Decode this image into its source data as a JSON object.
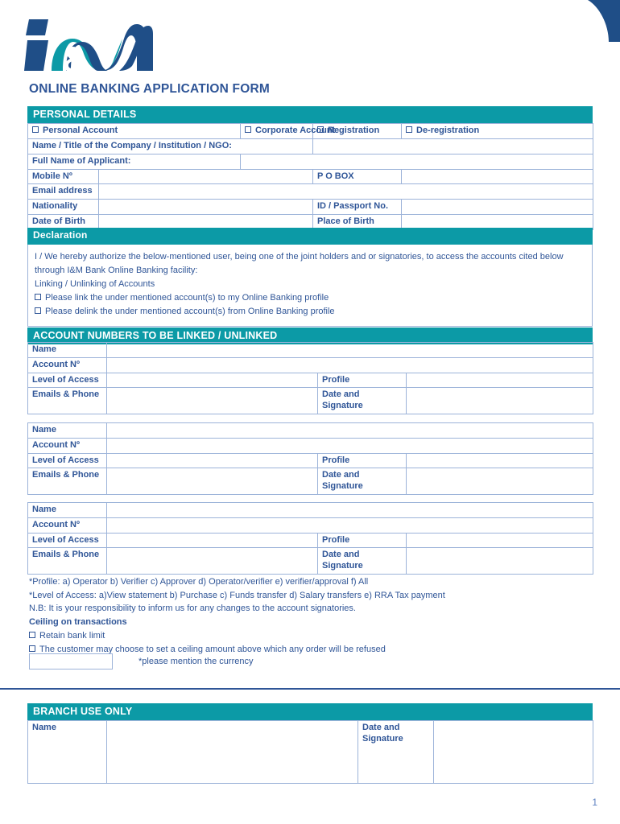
{
  "brand": {
    "logo_name": "i&M",
    "navy": "#1f4e87",
    "teal": "#0c9aa6",
    "text_blue": "#2f5597",
    "border_blue": "#9cb3d9"
  },
  "page_title": "ONLINE BANKING APPLICATION FORM",
  "personal_details": {
    "band": "PERSONAL DETAILS",
    "checkboxes": [
      "Personal Account",
      "Corporate Account",
      "Registration",
      "De-registration"
    ],
    "rows": [
      {
        "label": "Name / Title of the Company / Institution / NGO:",
        "value": ""
      },
      {
        "label": "Full Name of Applicant:",
        "value": ""
      }
    ],
    "pairs": [
      {
        "label_left": "Mobile Nº",
        "value_left": "",
        "label_right": "P O BOX",
        "value_right": ""
      },
      {
        "label_left": "Email address",
        "value_left": "",
        "label_right": "",
        "value_right": ""
      },
      {
        "label_left": "Nationality",
        "value_left": "",
        "label_right": "ID / Passport No.",
        "value_right": ""
      },
      {
        "label_left": "Date of Birth",
        "value_left": "",
        "label_right": "Place of Birth",
        "value_right": ""
      }
    ]
  },
  "declaration": {
    "band": "Declaration",
    "paragraph": "I / We hereby authorize the below-mentioned user, being one of the joint holders and or signatories, to access the accounts cited below through I&M Bank Online Banking facility:",
    "subheading": "Linking / Unlinking of Accounts",
    "options": [
      "Please link the under mentioned account(s) to my Online Banking profile",
      "Please delink the under mentioned account(s) from Online Banking profile"
    ]
  },
  "accounts": {
    "band": "ACCOUNT NUMBERS TO BE LINKED / UNLINKED",
    "labels": {
      "name": "Name",
      "account_no": "Account Nº",
      "level_of_access": "Level of Access",
      "profile": "Profile",
      "emails_phone": "Emails & Phone",
      "date_signature": "Date and Signature"
    },
    "blocks": [
      {
        "name": "",
        "account_no": "",
        "level_of_access": "",
        "profile": "",
        "emails_phone": "",
        "date_signature": ""
      },
      {
        "name": "",
        "account_no": "",
        "level_of_access": "",
        "profile": "",
        "emails_phone": "",
        "date_signature": ""
      },
      {
        "name": "",
        "account_no": "",
        "level_of_access": "",
        "profile": "",
        "emails_phone": "",
        "date_signature": ""
      }
    ]
  },
  "notes": {
    "profile_legend": "*Profile: a) Operator  b) Verifier  c)   Approver  d) Operator/verifier  e) verifier/approval  f) All",
    "access_legend": "*Level of Access:  a)View statement     b) Purchase  c) Funds transfer    d) Salary transfers e) RRA Tax payment",
    "nb": "N.B: It is your responsibility to inform us for any changes to the account signatories.",
    "ceiling_heading": "Ceiling on transactions",
    "ceiling_options": [
      "Retain bank limit",
      "The customer may choose to set a ceiling amount above which any order will be refused"
    ],
    "currency_value": "",
    "currency_note": "*please mention the currency"
  },
  "branch": {
    "band": "BRANCH USE ONLY",
    "labels": {
      "name": "Name",
      "date_signature": "Date and Signature"
    },
    "name_value": "",
    "date_signature_value": ""
  },
  "page_number": "1"
}
